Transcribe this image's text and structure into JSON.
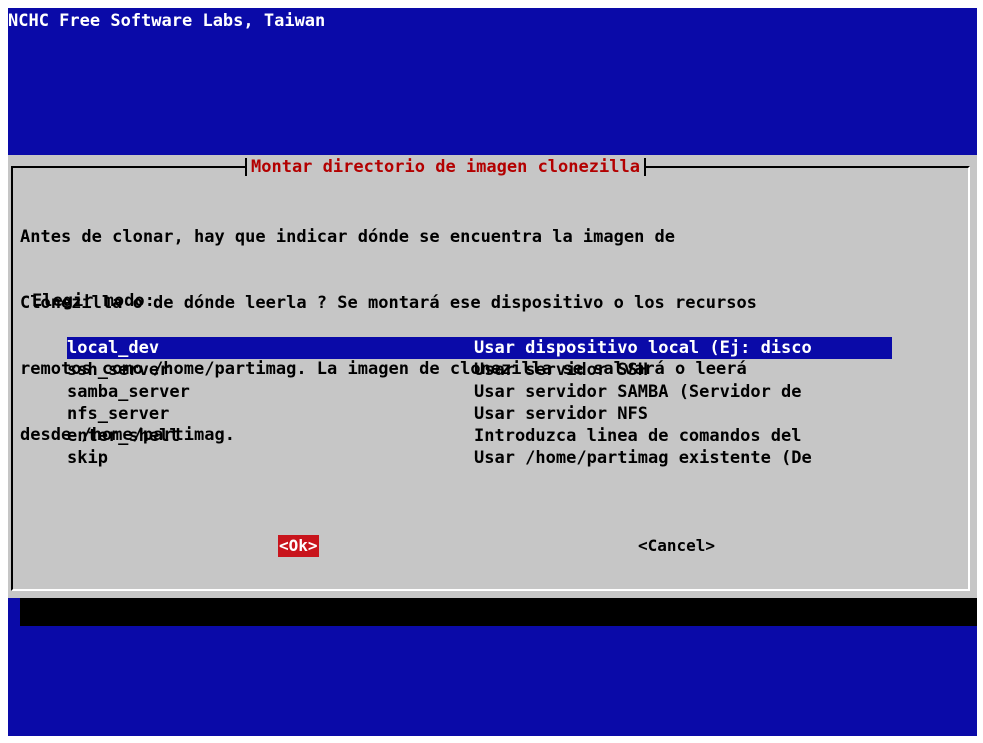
{
  "backtitle": "NCHC Free Software Labs, Taiwan",
  "dialog": {
    "title": "Montar directorio de imagen clonezilla",
    "prompt_lines": [
      "Antes de clonar, hay que indicar dónde se encuentra la imagen de",
      "Clonezilla o de dónde leerla ? Se montará ese dispositivo o los recursos",
      "remotos como /home/partimag. La imagen de clonezilla se salvará o leerá",
      "desde /home/partimag."
    ],
    "menu_label": "Elegir modo:",
    "menu": [
      {
        "tag": "local_dev",
        "desc": "Usar dispositivo local (Ej: disco",
        "selected": true
      },
      {
        "tag": "ssh_server",
        "desc": "Usar servidor SSH",
        "selected": false
      },
      {
        "tag": "samba_server",
        "desc": "Usar servidor SAMBA (Servidor de",
        "selected": false
      },
      {
        "tag": "nfs_server",
        "desc": "Usar servidor NFS",
        "selected": false
      },
      {
        "tag": "enter_shell",
        "desc": "Introduzca linea de comandos del",
        "selected": false
      },
      {
        "tag": "skip",
        "desc": "Usar /home/partimag existente (De",
        "selected": false
      }
    ],
    "buttons": {
      "ok": "<Ok>",
      "cancel": "<Cancel>"
    }
  },
  "colors": {
    "screen_bg": "#0a0aa8",
    "dialog_bg": "#c6c6c6",
    "title_text": "#b30000",
    "ok_bg": "#c8141c"
  }
}
